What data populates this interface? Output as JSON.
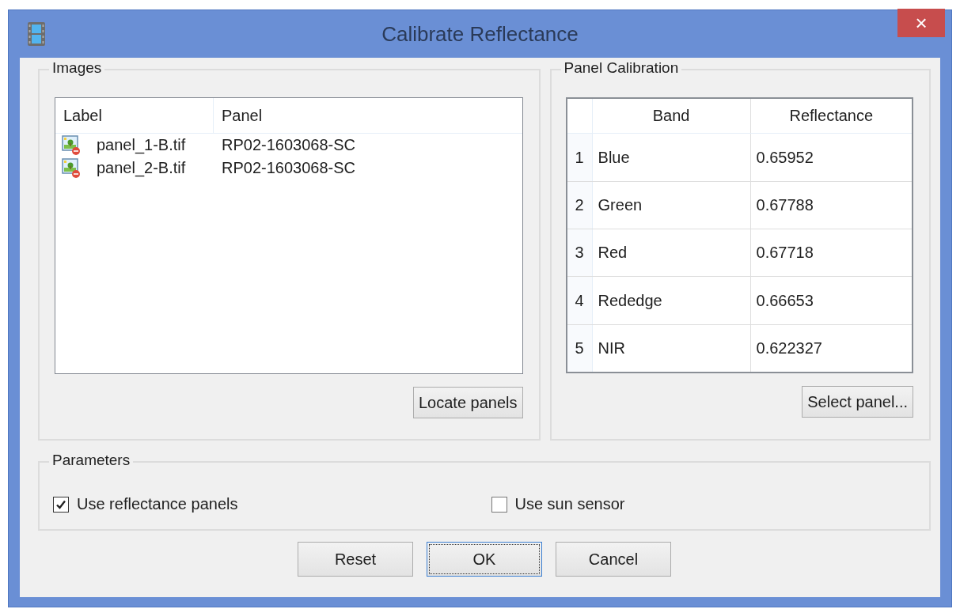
{
  "window": {
    "title": "Calibrate Reflectance",
    "close": "×"
  },
  "images": {
    "title": "Images",
    "columns": [
      "Label",
      "Panel"
    ],
    "rows": [
      {
        "label": "panel_1-B.tif",
        "panel": "RP02-1603068-SC"
      },
      {
        "label": "panel_2-B.tif",
        "panel": "RP02-1603068-SC"
      }
    ],
    "button": "Locate panels"
  },
  "calibration": {
    "title": "Panel Calibration",
    "columns": [
      "Band",
      "Reflectance"
    ],
    "rows": [
      {
        "index": "1",
        "band": "Blue",
        "reflectance": "0.65952"
      },
      {
        "index": "2",
        "band": "Green",
        "reflectance": "0.67788"
      },
      {
        "index": "3",
        "band": "Red",
        "reflectance": "0.67718"
      },
      {
        "index": "4",
        "band": "Rededge",
        "reflectance": "0.66653"
      },
      {
        "index": "5",
        "band": "NIR",
        "reflectance": "0.622327"
      }
    ],
    "button": "Select panel..."
  },
  "parameters": {
    "title": "Parameters",
    "options": [
      {
        "label": "Use reflectance panels",
        "checked": true
      },
      {
        "label": "Use sun sensor",
        "checked": false
      }
    ]
  },
  "buttons": [
    {
      "label": "Reset",
      "focused": false
    },
    {
      "label": "OK",
      "focused": true
    },
    {
      "label": "Cancel",
      "focused": false
    }
  ]
}
